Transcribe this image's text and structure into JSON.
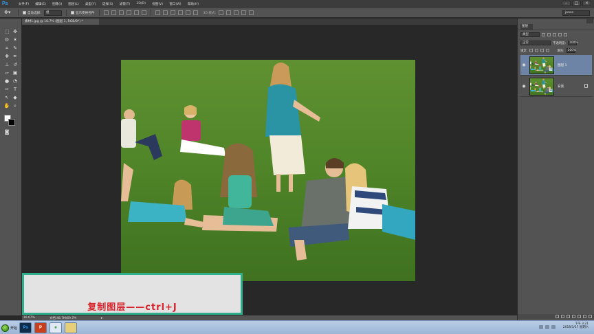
{
  "app": {
    "logo": "Ps"
  },
  "menu": [
    "文件(F)",
    "编辑(E)",
    "图像(I)",
    "图层(L)",
    "类型(Y)",
    "选择(S)",
    "滤镜(T)",
    "3D(D)",
    "视图(V)",
    "窗口(W)",
    "帮助(H)"
  ],
  "window_controls": [
    "–",
    "□",
    "×"
  ],
  "options": {
    "auto_select_label": "自动选择:",
    "auto_select_value": "组",
    "show_transform_label": "显示变换控件",
    "mode_3d_label": "3D 模式:",
    "workspace": "jonse"
  },
  "document": {
    "tab_title": "素材1.jpg @ 16.7% (图层 1, RGB/8*) *",
    "zoom": "16.67%",
    "doc_info": "文档:48.7M/69.7M"
  },
  "colors": {
    "foreground": "#ffffff",
    "background": "#000000",
    "caption_border": "#2fae8a",
    "caption_text": "#d8242a",
    "selected_layer": "#6d84a6"
  },
  "caption": {
    "text": "复制图层——ctrl+J"
  },
  "layers_panel": {
    "tab": "图层",
    "filter_kind": "类型",
    "blend_mode": "正常",
    "opacity_label": "不透明度:",
    "opacity_value": "100%",
    "lock_label": "锁定:",
    "fill_label": "填充:",
    "fill_value": "100%",
    "layers": [
      {
        "name": "图层 1",
        "visible": true,
        "selected": true,
        "locked": false
      },
      {
        "name": "背景",
        "visible": true,
        "selected": false,
        "locked": true
      }
    ]
  },
  "taskbar": {
    "start_label": "开始",
    "apps": [
      "Ps",
      "P",
      "e",
      "folder"
    ],
    "time": "下午 3:21",
    "date": "2018/3/17 星期六"
  }
}
